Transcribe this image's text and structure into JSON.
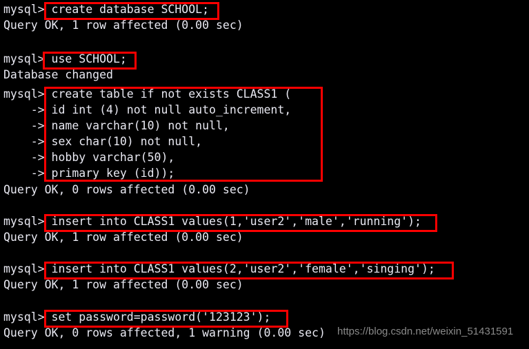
{
  "terminal": {
    "background_color": "#000000",
    "text_color": "#e9e9f2",
    "annotation_color": "#ff0000",
    "watermark_color": "#8a8a8a",
    "lines": [
      {
        "text": "mysql> create database SCHOOL;"
      },
      {
        "text": "Query OK, 1 row affected (0.00 sec)"
      },
      {
        "text": ""
      },
      {
        "text": "mysql> use SCHOOL;"
      },
      {
        "text": "Database changed"
      },
      {
        "text": "mysql> create table if not exists CLASS1 ("
      },
      {
        "text": "    -> id int (4) not null auto_increment,"
      },
      {
        "text": "    -> name varchar(10) not null,"
      },
      {
        "text": "    -> sex char(10) not null,"
      },
      {
        "text": "    -> hobby varchar(50),"
      },
      {
        "text": "    -> primary key (id));"
      },
      {
        "text": "Query OK, 0 rows affected (0.00 sec)"
      },
      {
        "text": ""
      },
      {
        "text": "mysql> insert into CLASS1 values(1,'user2','male','running');"
      },
      {
        "text": "Query OK, 1 row affected (0.00 sec)"
      },
      {
        "text": ""
      },
      {
        "text": "mysql> insert into CLASS1 values(2,'user2','female','singing');"
      },
      {
        "text": "Query OK, 1 row affected (0.00 sec)"
      },
      {
        "text": ""
      },
      {
        "text": "mysql> set password=password('123123');"
      },
      {
        "text": "Query OK, 0 rows affected, 1 warning (0.00 sec)"
      }
    ],
    "annotations": [
      {
        "label": "create database SCHOOL;"
      },
      {
        "label": "use SCHOOL;"
      },
      {
        "label": "create table if not exists CLASS1 ( ... primary key (id));"
      },
      {
        "label": "insert into CLASS1 values(1,'user2','male','running');"
      },
      {
        "label": "insert into CLASS1 values(2,'user2','female','singing');"
      },
      {
        "label": "set password=password('123123');"
      }
    ],
    "watermark": "https://blog.csdn.net/weixin_51431591"
  }
}
